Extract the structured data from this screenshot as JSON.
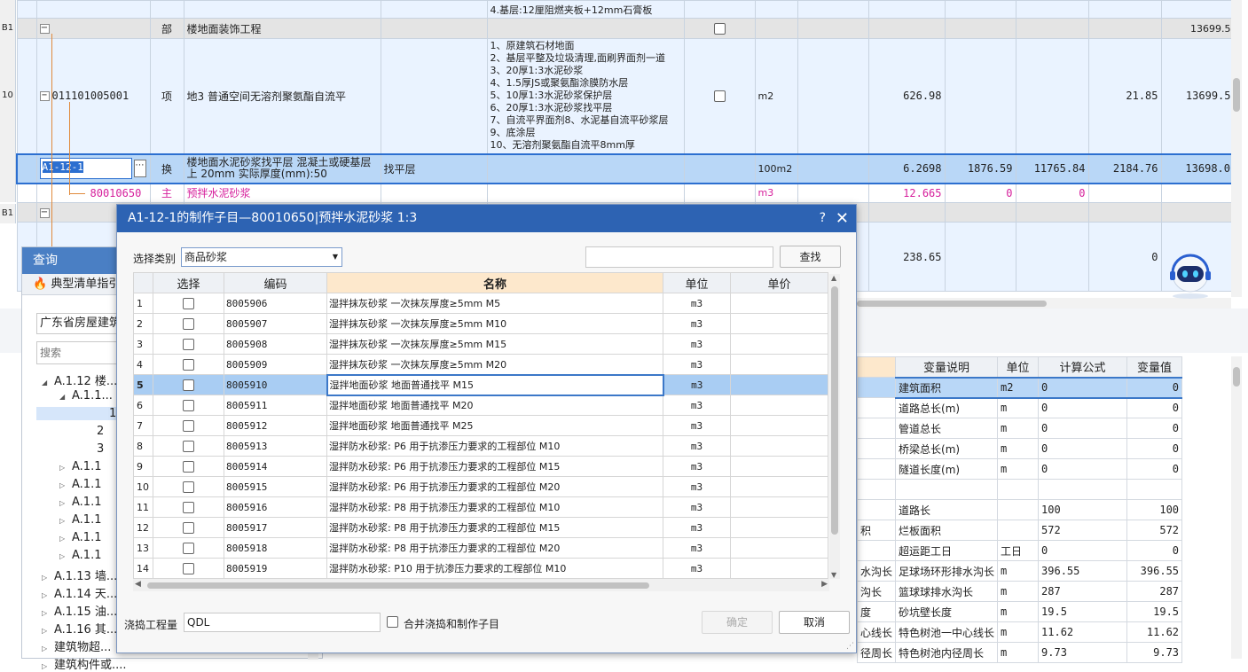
{
  "top_table": {
    "partial_row_desc": "4.基层:12厘阻燃夹板+12mm石膏板",
    "section_row": {
      "code": "B1",
      "type": "部",
      "name": "楼地面装饰工程",
      "total": "13699.5"
    },
    "item_row": {
      "row_no": "10",
      "code": "011101005001",
      "type": "项",
      "name": "地3  普通空间无溶剂聚氨酯自流平",
      "features": [
        "1、原建筑石材地面",
        "2、基层平整及垃圾清理,面刷界面剂一道",
        "3、20厚1:3水泥砂浆",
        "4、1.5厚JS或聚氨酯涂膜防水层",
        "5、10厚1:3水泥砂浆保护层",
        "6、20厚1:3水泥砂浆找平层",
        "7、自流平界面剂8、水泥基自流平砂浆层",
        "9、底涂层",
        "10、无溶剂聚氨酯自流平8mm厚"
      ],
      "unit": "m2",
      "qty": "626.98",
      "unit_price": "21.85",
      "total": "13699.5"
    },
    "sub_row": {
      "code": "A1-12-1",
      "type": "换",
      "name": "楼地面水泥砂浆找平层 混凝土或硬基层上 20mm  实际厚度(mm):50",
      "feature": "找平层",
      "unit": "100m2",
      "qty": "6.2698",
      "price": "1876.59",
      "amount": "11765.84",
      "unit_price": "2184.76",
      "total": "13698.0"
    },
    "material_row": {
      "code": "80010650",
      "type": "主",
      "name": "预拌水泥砂浆",
      "unit": "m3",
      "qty": "12.665",
      "v1": "0",
      "v2": "0"
    },
    "section_row2": {
      "code": "B1"
    },
    "lower_row": {
      "qty": "238.65",
      "unit_price": "0"
    }
  },
  "query_panel": {
    "title": "查询",
    "tab": "典型清单指引",
    "region": "广东省房屋建筑...",
    "search_placeholder": "搜索",
    "tree": [
      "A.1.12 楼...",
      "A.1.1...",
      "1",
      "2",
      "3",
      "A.1.1",
      "A.1.1",
      "A.1.1",
      "A.1.1",
      "A.1.1",
      "A.1.1",
      "A.1.13 墙...",
      "A.1.14 天...",
      "A.1.15 油...",
      "A.1.16 其...",
      "建筑物超...",
      "建筑构件或...."
    ]
  },
  "var_table": {
    "headers": [
      "变量说明",
      "单位",
      "计算公式",
      "变量值"
    ],
    "rows": [
      {
        "pre": "",
        "name": "建筑面积",
        "unit": "m2",
        "formula": "0",
        "value": "0"
      },
      {
        "pre": "",
        "name": "道路总长(m)",
        "unit": "m",
        "formula": "0",
        "value": "0"
      },
      {
        "pre": "",
        "name": "管道总长",
        "unit": "m",
        "formula": "0",
        "value": "0"
      },
      {
        "pre": "",
        "name": "桥梁总长(m)",
        "unit": "m",
        "formula": "0",
        "value": "0"
      },
      {
        "pre": "",
        "name": "隧道长度(m)",
        "unit": "m",
        "formula": "0",
        "value": "0"
      },
      {
        "pre": "",
        "name": "",
        "unit": "",
        "formula": "",
        "value": ""
      },
      {
        "pre": "",
        "name": "道路长",
        "unit": "",
        "formula": "100",
        "value": "100"
      },
      {
        "pre": "积",
        "name": "烂板面积",
        "unit": "",
        "formula": "572",
        "value": "572"
      },
      {
        "pre": "",
        "name": "超运距工日",
        "unit": "工日",
        "formula": "0",
        "value": "0"
      },
      {
        "pre": "水沟长",
        "name": "足球场环形排水沟长",
        "unit": "m",
        "formula": "396.55",
        "value": "396.55"
      },
      {
        "pre": "沟长",
        "name": "篮球球排水沟长",
        "unit": "m",
        "formula": "287",
        "value": "287"
      },
      {
        "pre": "度",
        "name": "砂坑壁长度",
        "unit": "m",
        "formula": "19.5",
        "value": "19.5"
      },
      {
        "pre": "心线长",
        "name": "特色树池一中心线长",
        "unit": "m",
        "formula": "11.62",
        "value": "11.62"
      },
      {
        "pre": "径周长",
        "name": "特色树池内径周长",
        "unit": "m",
        "formula": "9.73",
        "value": "9.73"
      }
    ]
  },
  "dialog": {
    "title": "A1-12-1的制作子目—80010650|预拌水泥砂浆 1:3",
    "help": "?",
    "close": "✕",
    "category_label": "选择类别",
    "category_value": "商品砂浆",
    "search_value": "",
    "search_button": "查找",
    "headers": {
      "sel": "选择",
      "code": "编码",
      "name": "名称",
      "unit": "单位",
      "price": "单价"
    },
    "rows": [
      {
        "no": "1",
        "code": "8005906",
        "name": "湿拌抹灰砂浆 一次抹灰厚度≥5mm M5",
        "unit": "m3"
      },
      {
        "no": "2",
        "code": "8005907",
        "name": "湿拌抹灰砂浆 一次抹灰厚度≥5mm M10",
        "unit": "m3"
      },
      {
        "no": "3",
        "code": "8005908",
        "name": "湿拌抹灰砂浆 一次抹灰厚度≥5mm M15",
        "unit": "m3"
      },
      {
        "no": "4",
        "code": "8005909",
        "name": "湿拌抹灰砂浆 一次抹灰厚度≥5mm M20",
        "unit": "m3"
      },
      {
        "no": "5",
        "code": "8005910",
        "name": "湿拌地面砂浆 地面普通找平 M15",
        "unit": "m3"
      },
      {
        "no": "6",
        "code": "8005911",
        "name": "湿拌地面砂浆 地面普通找平 M20",
        "unit": "m3"
      },
      {
        "no": "7",
        "code": "8005912",
        "name": "湿拌地面砂浆 地面普通找平 M25",
        "unit": "m3"
      },
      {
        "no": "8",
        "code": "8005913",
        "name": "湿拌防水砂浆: P6 用于抗渗压力要求的工程部位 M10",
        "unit": "m3"
      },
      {
        "no": "9",
        "code": "8005914",
        "name": "湿拌防水砂浆: P6 用于抗渗压力要求的工程部位 M15",
        "unit": "m3"
      },
      {
        "no": "10",
        "code": "8005915",
        "name": "湿拌防水砂浆: P6 用于抗渗压力要求的工程部位 M20",
        "unit": "m3"
      },
      {
        "no": "11",
        "code": "8005916",
        "name": "湿拌防水砂浆: P8 用于抗渗压力要求的工程部位 M10",
        "unit": "m3"
      },
      {
        "no": "12",
        "code": "8005917",
        "name": "湿拌防水砂浆: P8 用于抗渗压力要求的工程部位 M15",
        "unit": "m3"
      },
      {
        "no": "13",
        "code": "8005918",
        "name": "湿拌防水砂浆: P8 用于抗渗压力要求的工程部位 M20",
        "unit": "m3"
      },
      {
        "no": "14",
        "code": "8005919",
        "name": "湿拌防水砂浆: P10 用于抗渗压力要求的工程部位 M10",
        "unit": "m3"
      }
    ],
    "selected_row": "5",
    "qty_label": "浇捣工程量",
    "qty_value": "QDL",
    "merge_label": "合并浇捣和制作子目",
    "ok": "确定",
    "cancel": "取消"
  }
}
